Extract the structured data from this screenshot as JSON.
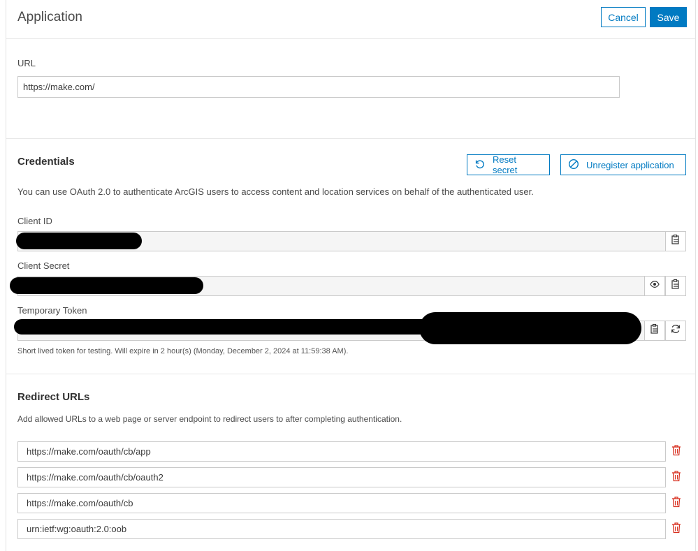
{
  "header": {
    "title": "Application",
    "cancel_label": "Cancel",
    "save_label": "Save"
  },
  "url_section": {
    "label": "URL",
    "value": "https://make.com/"
  },
  "credentials": {
    "title": "Credentials",
    "reset_label": "Reset secret",
    "unregister_label": "Unregister application",
    "description": "You can use OAuth 2.0 to authenticate ArcGIS users to access content and location services on behalf of the authenticated user.",
    "client_id_label": "Client ID",
    "client_secret_label": "Client Secret",
    "temp_token_label": "Temporary Token",
    "token_note": "Short lived token for testing. Will expire in 2 hour(s) (Monday, December 2, 2024 at 11:59:38 AM)."
  },
  "redirect": {
    "title": "Redirect URLs",
    "description": "Add allowed URLs to a web page or server endpoint to redirect users to after completing authentication.",
    "urls": [
      "https://make.com/oauth/cb/app",
      "https://make.com/oauth/cb/oauth2",
      "https://make.com/oauth/cb",
      "urn:ietf:wg:oauth:2.0:oob"
    ]
  },
  "colors": {
    "accent": "#007ac2",
    "danger": "#d83020"
  },
  "icons": {
    "reset": "reset-icon",
    "unregister": "block-icon",
    "copy": "clipboard-icon",
    "view": "eye-icon",
    "refresh": "refresh-icon",
    "delete": "trash-icon"
  }
}
